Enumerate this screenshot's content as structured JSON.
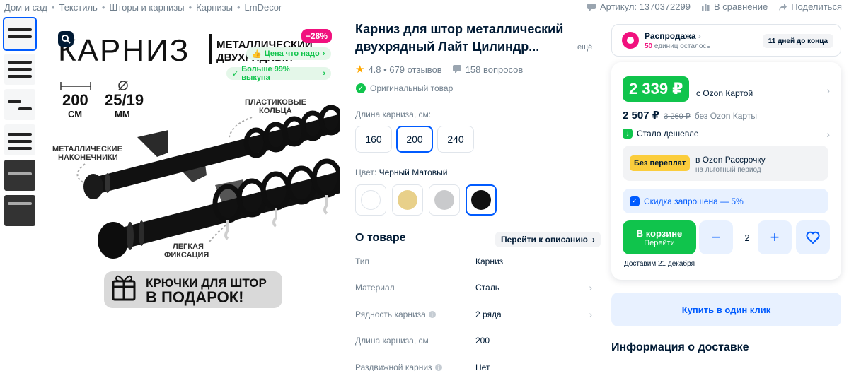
{
  "breadcrumbs": [
    "Дом и сад",
    "Текстиль",
    "Шторы и карнизы",
    "Карнизы",
    "LmDecor"
  ],
  "header": {
    "article": "Артикул: 1370372299",
    "compare": "В сравнение",
    "share": "Поделиться"
  },
  "gallery": {
    "discount": "−28%",
    "promo1": "Цена что надо",
    "promo2": "Больше 99% выкупа",
    "headline": "КАРНИЗ",
    "headline_sub1": "МЕТАЛЛИЧЕСКИЙ",
    "headline_sub2": "ДВУХРЯДНЫЙ",
    "len_value": "200",
    "len_unit": "СМ",
    "diam_value": "25/19",
    "diam_unit": "ММ",
    "label_tips1": "МЕТАЛЛИЧЕСКИЕ",
    "label_tips2": "НАКОНЕЧНИКИ",
    "label_rings1": "ПЛАСТИКОВЫЕ",
    "label_rings2": "КОЛЬЦА",
    "label_fix1": "ЛЕГКАЯ",
    "label_fix2": "ФИКСАЦИЯ",
    "gift_line1": "КРЮЧКИ ДЛЯ ШТОР",
    "gift_line2": "В ПОДАРОК!"
  },
  "product": {
    "title": "Карниз для штор металлический двухрядный Лайт Цилиндр...",
    "title_more": "ещё",
    "rating": "4.8 • 679 отзывов",
    "questions": "158 вопросов",
    "original": "Оригинальный товар",
    "length_label": "Длина карниза, см:",
    "length_options": [
      "160",
      "200",
      "240"
    ],
    "length_selected": "200",
    "color_label": "Цвет:",
    "color_value": "Черный Матовый",
    "color_options": [
      {
        "name": "white",
        "hex": "#ffffff"
      },
      {
        "name": "gold",
        "hex": "#e8d08a"
      },
      {
        "name": "silver",
        "hex": "#c9cacc"
      },
      {
        "name": "black",
        "hex": "#111111"
      }
    ],
    "about_title": "О товаре",
    "about_link": "Перейти к описанию",
    "specs": [
      {
        "k": "Тип",
        "v": "Карниз",
        "chev": false,
        "info": false
      },
      {
        "k": "Материал",
        "v": "Сталь",
        "chev": true,
        "info": false
      },
      {
        "k": "Рядность карниза",
        "v": "2 ряда",
        "chev": true,
        "info": true
      },
      {
        "k": "Длина карниза, см",
        "v": "200",
        "chev": false,
        "info": false
      },
      {
        "k": "Раздвижной карниз",
        "v": "Нет",
        "chev": false,
        "info": true
      }
    ]
  },
  "sale": {
    "title": "Распродажа",
    "remaining_count": "50",
    "remaining_text": "единиц осталось",
    "days": "11 дней до конца"
  },
  "price": {
    "card_price": "2 339 ₽",
    "card_label": "с Ozon Картой",
    "regular": "2 507 ₽",
    "old": "3 260 ₽",
    "regular_label": "без Ozon Карты",
    "cheaper": "Стало дешевле",
    "installment_badge": "Без переплат",
    "installment_title": "в Ozon Рассрочку",
    "installment_sub": "на льготный период",
    "discount_request": "Скидка запрошена — 5%",
    "cart_line1": "В корзине",
    "cart_line2": "Перейти",
    "qty_minus": "−",
    "qty": "2",
    "qty_plus": "+",
    "delivery": "Доставим 21 декабря",
    "buy_one_click": "Купить в один клик"
  },
  "delivery_info_title": "Информация о доставке",
  "colors": {
    "ozon_blue": "#005bff",
    "green": "#10c44c",
    "pink": "#f1117e"
  }
}
